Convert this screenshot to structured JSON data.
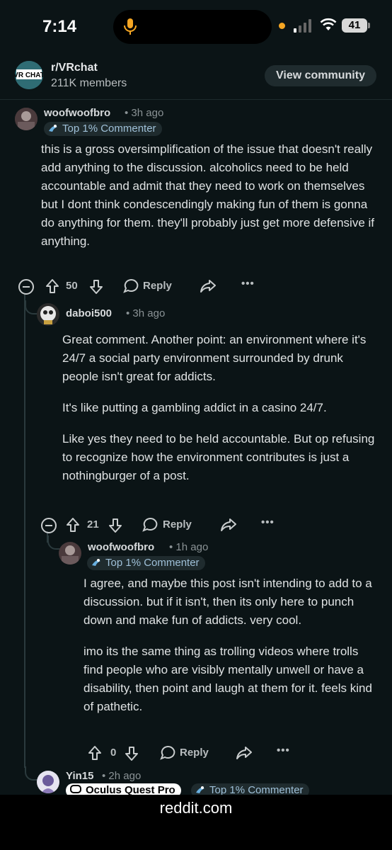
{
  "status_bar": {
    "time": "7:14",
    "battery": "41"
  },
  "community": {
    "avatar_text": "VR CHAT",
    "name": "r/VRchat",
    "members": "211K members",
    "view_button": "View community"
  },
  "comments": [
    {
      "username": "woofwoofbro",
      "time": "3h ago",
      "flair": "Top 1% Commenter",
      "paragraphs": [
        "this is a gross oversimplification of the issue that doesn't really add anything to the discussion. alcoholics need to be held accountable and admit that they need to work on themselves but I dont think condescendingly making fun of them is gonna do anything for them. they'll probably just get more defensive if anything."
      ],
      "votes": "50",
      "reply_label": "Reply"
    },
    {
      "username": "daboi500",
      "time": "3h ago",
      "paragraphs": [
        "Great comment. Another point: an environment where it's 24/7 a social party environment surrounded by drunk people isn't great for addicts.",
        "It's like putting a gambling addict in a casino 24/7.",
        "Like yes they need to be held accountable. But op refusing to recognize how the environment contributes is just a nothingburger of a post."
      ],
      "votes": "21",
      "reply_label": "Reply"
    },
    {
      "username": "woofwoofbro",
      "time": "1h ago",
      "flair": "Top 1% Commenter",
      "paragraphs": [
        "I agree, and maybe this post isn't intending to add to a discussion. but if it isn't, then its only here to punch down and make fun of addicts. very cool.",
        "imo its the same thing as trolling videos where trolls find people who are visibly mentally unwell or have a disability, then point and laugh at them for it. feels kind of pathetic."
      ],
      "votes": "0",
      "reply_label": "Reply"
    },
    {
      "username": "Yin15",
      "time": "2h ago",
      "flair_device": "Oculus Quest Pro",
      "flair": "Top 1% Commenter"
    }
  ],
  "footer": {
    "domain": "reddit.com"
  },
  "colors": {
    "background": "#0b1416",
    "flair_text": "#9fc0d8",
    "thread_line": "#2b3a3d"
  }
}
